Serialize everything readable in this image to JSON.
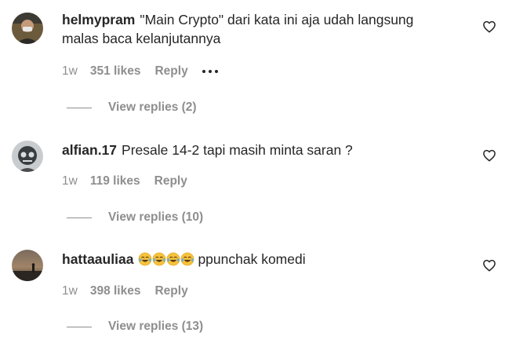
{
  "comments": [
    {
      "username": "helmypram",
      "text_line1": "\"Main Crypto\" dari kata ini aja udah langsung",
      "text_line2": "malas baca kelanjutannya",
      "time": "1w",
      "likes": "351 likes",
      "reply_label": "Reply",
      "more_icon": "more-options-icon",
      "view_replies": "View replies (2)"
    },
    {
      "username": "alfian.17",
      "text": "Presale 14-2 tapi masih minta saran ?",
      "time": "1w",
      "likes": "119 likes",
      "reply_label": "Reply",
      "view_replies": "View replies (10)"
    },
    {
      "username": "hattaauliaa",
      "emojis": [
        "face-with-tears-of-joy",
        "face-with-tears-of-joy",
        "face-with-tears-of-joy",
        "face-with-tears-of-joy"
      ],
      "text": "ppunchak komedi",
      "time": "1w",
      "likes": "398 likes",
      "reply_label": "Reply",
      "view_replies": "View replies (13)"
    }
  ],
  "colors": {
    "primary_text": "#262626",
    "secondary_text": "#8e8e8e",
    "emoji_yellow": "#f7c23b",
    "emoji_tear": "#5aaee8"
  },
  "icons": {
    "like": "heart-outline-icon",
    "emoji": "face-with-tears-of-joy"
  }
}
